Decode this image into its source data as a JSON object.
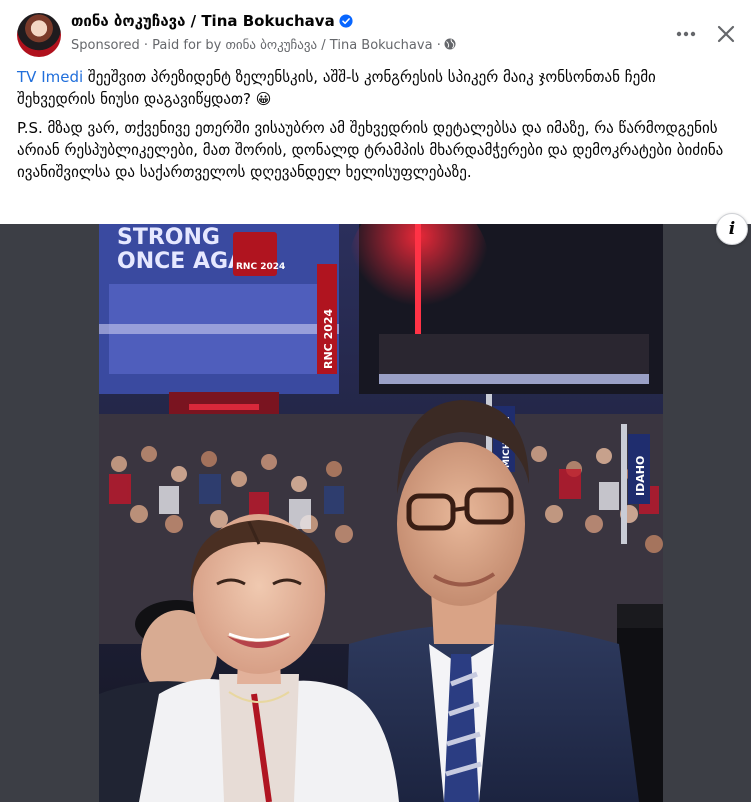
{
  "post": {
    "page_name": "თინა ბოკუჩავა / Tina Bokuchava",
    "sponsored": "Sponsored",
    "paid_for": "Paid for by თინა ბოკუჩავა / Tina Bokuchava",
    "separator": "·",
    "text_link": "TV Imedi",
    "text_line1_rest": " შეეშვით პრეზიდენტ ზელენსკის, აშშ-ს კონგრესის სპიკერ მაიკ ჯონსონთან ჩემი შეხვედრის ნიუსი დაგავიწყდათ? 😀",
    "text_paragraph2": "P.S. მზად ვარ, თქვენივე ეთერში ვისაუბრო ამ შეხვედრის დეტალებსა და იმაზე, რა წარმოდგენის არიან რესპუბლიკელები, მათ შორის, დონალდ ტრამპის მხარდამჭერები და დემოკრატები ბიძინა ივანიშვილსა და საქართველოს დღევანდელ ხელისუფლებაზე."
  },
  "photo_signs": {
    "banner_line1": "STRONG",
    "banner_line2": "ONCE AGAIN",
    "rnc_badge": "RNC 2024",
    "rnc_vertical": "RNC 2024",
    "state_sign": "IDAHO",
    "state_sign2": "MICHIGAN"
  },
  "icons": {
    "verified": "verified-badge-icon",
    "globe": "globe-icon",
    "more": "more-options-icon",
    "close": "close-icon",
    "info": "info-icon"
  },
  "info_glyph": "i",
  "colors": {
    "link": "#216fdb",
    "verified": "#0866ff",
    "secondary_text": "#65676b",
    "media_background": "#3c3e45"
  }
}
